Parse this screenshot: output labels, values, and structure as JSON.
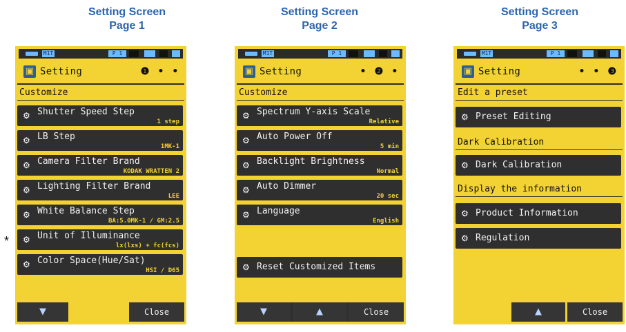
{
  "captions": [
    {
      "line1": "Setting Screen",
      "line2": "Page 1"
    },
    {
      "line1": "Setting Screen",
      "line2": "Page 2"
    },
    {
      "line1": "Setting Screen",
      "line2": "Page 3"
    }
  ],
  "status": {
    "mem": "M1T",
    "ch": "P 1"
  },
  "header": {
    "title": "Setting",
    "page1": "❶ • •",
    "page2": "• ❷ •",
    "page3": "• • ❸"
  },
  "asterisk": "*",
  "page1": {
    "section": "Customize",
    "items": [
      {
        "label": "Shutter Speed Step",
        "value": "1 step"
      },
      {
        "label": "LB Step",
        "value": "1MK-1"
      },
      {
        "label": "Camera Filter Brand",
        "value": "KODAK WRATTEN 2"
      },
      {
        "label": "Lighting Filter Brand",
        "value": "LEE"
      },
      {
        "label": "White Balance Step",
        "value": "BA:5.0MK-1 / GM:2.5"
      },
      {
        "label": "Unit of Illuminance",
        "value": "lx(lxs) + fc(fcs)"
      },
      {
        "label": "Color Space(Hue/Sat)",
        "value": "HSI / D65"
      }
    ],
    "footer": {
      "down": "▼",
      "close": "Close"
    }
  },
  "page2": {
    "section": "Customize",
    "items": [
      {
        "label": "Spectrum Y-axis Scale",
        "value": "Relative"
      },
      {
        "label": "Auto Power Off",
        "value": "5 min"
      },
      {
        "label": "Backlight Brightness",
        "value": "Normal"
      },
      {
        "label": "Auto Dimmer",
        "value": "20 sec"
      },
      {
        "label": "Language",
        "value": "English"
      }
    ],
    "reset": "Reset Customized Items",
    "footer": {
      "down": "▼",
      "up": "▲",
      "close": "Close"
    }
  },
  "page3": {
    "sections": [
      {
        "title": "Edit a preset",
        "item": "Preset Editing"
      },
      {
        "title": "Dark Calibration",
        "item": "Dark Calibration"
      },
      {
        "title": "Display the information",
        "item": "Product Information"
      }
    ],
    "extra_item": "Regulation",
    "footer": {
      "up": "▲",
      "close": "Close"
    }
  },
  "icons": {
    "gear": "⚙",
    "setting": "▣"
  }
}
